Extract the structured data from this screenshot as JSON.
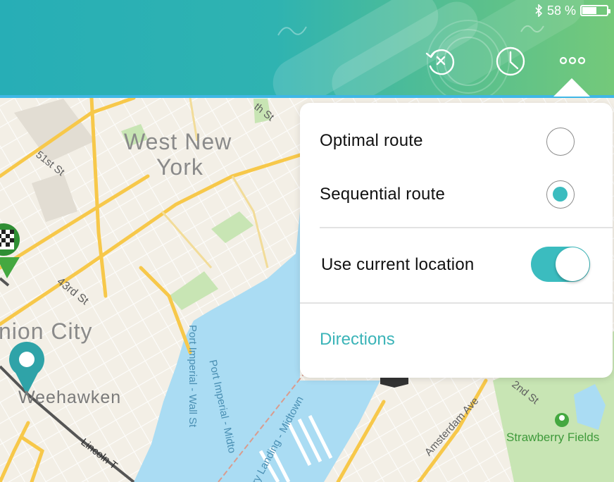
{
  "status_bar": {
    "battery_text": "58 %",
    "battery_level": 0.58,
    "bluetooth_icon": "bluetooth-icon"
  },
  "toolbar": {
    "undo_icon": "undo-clear-icon",
    "history_icon": "clock-icon",
    "more_icon": "more-dots-icon"
  },
  "colors": {
    "accent": "#3bbcbf",
    "header_start": "#27aeb6",
    "header_end": "#74c97a",
    "water": "#aadcf3",
    "park": "#c8e5b4",
    "road_major": "#f7c84a"
  },
  "map": {
    "labels": {
      "west_new_york_1": "West New",
      "west_new_york_2": "York",
      "union_city": "nion City",
      "weehawken": "Weehawken",
      "st_51": "51st St",
      "st_43": "43rd St",
      "st_th": "th St",
      "port_imperial_wall": "Port Imperial - Wall St",
      "port_imperial_mid": "Port Imperial - Midto",
      "ferry_landing": "rry Landing - Midtown",
      "amsterdam": "Amsterdam Ave",
      "st_2nd": "2nd St",
      "strawberry_fields": "Strawberry Fields",
      "lincoln": "Lincoln T"
    }
  },
  "route_menu": {
    "optimal_label": "Optimal route",
    "optimal_selected": false,
    "sequential_label": "Sequential route",
    "sequential_selected": true,
    "current_location_label": "Use current location",
    "current_location_enabled": true,
    "directions_label": "Directions"
  }
}
